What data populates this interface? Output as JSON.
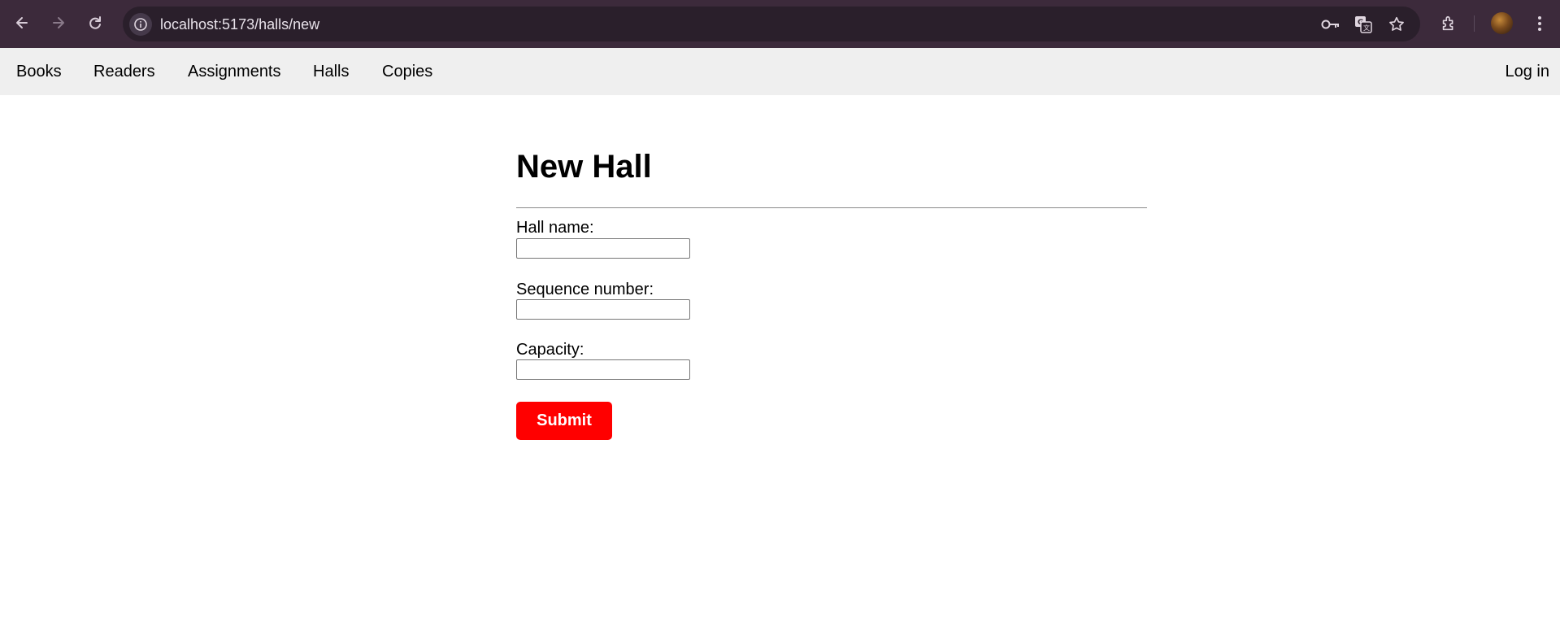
{
  "browser": {
    "url": "localhost:5173/halls/new",
    "colors": {
      "toolbar": "#3c2a3b",
      "omnibox": "#2a1f2b"
    },
    "icons": [
      "back-arrow-icon",
      "forward-arrow-icon",
      "reload-icon",
      "site-info-icon",
      "password-key-icon",
      "translate-icon",
      "bookmark-star-icon",
      "extensions-icon",
      "profile-avatar",
      "more-menu-icon"
    ]
  },
  "nav": {
    "items": [
      "Books",
      "Readers",
      "Assignments",
      "Halls",
      "Copies"
    ],
    "login": "Log in"
  },
  "form": {
    "title": "New Hall",
    "fields": [
      {
        "label": "Hall name:",
        "value": ""
      },
      {
        "label": "Sequence number:",
        "value": ""
      },
      {
        "label": "Capacity:",
        "value": ""
      }
    ],
    "submit_label": "Submit",
    "submit_color": "#ff0000"
  }
}
